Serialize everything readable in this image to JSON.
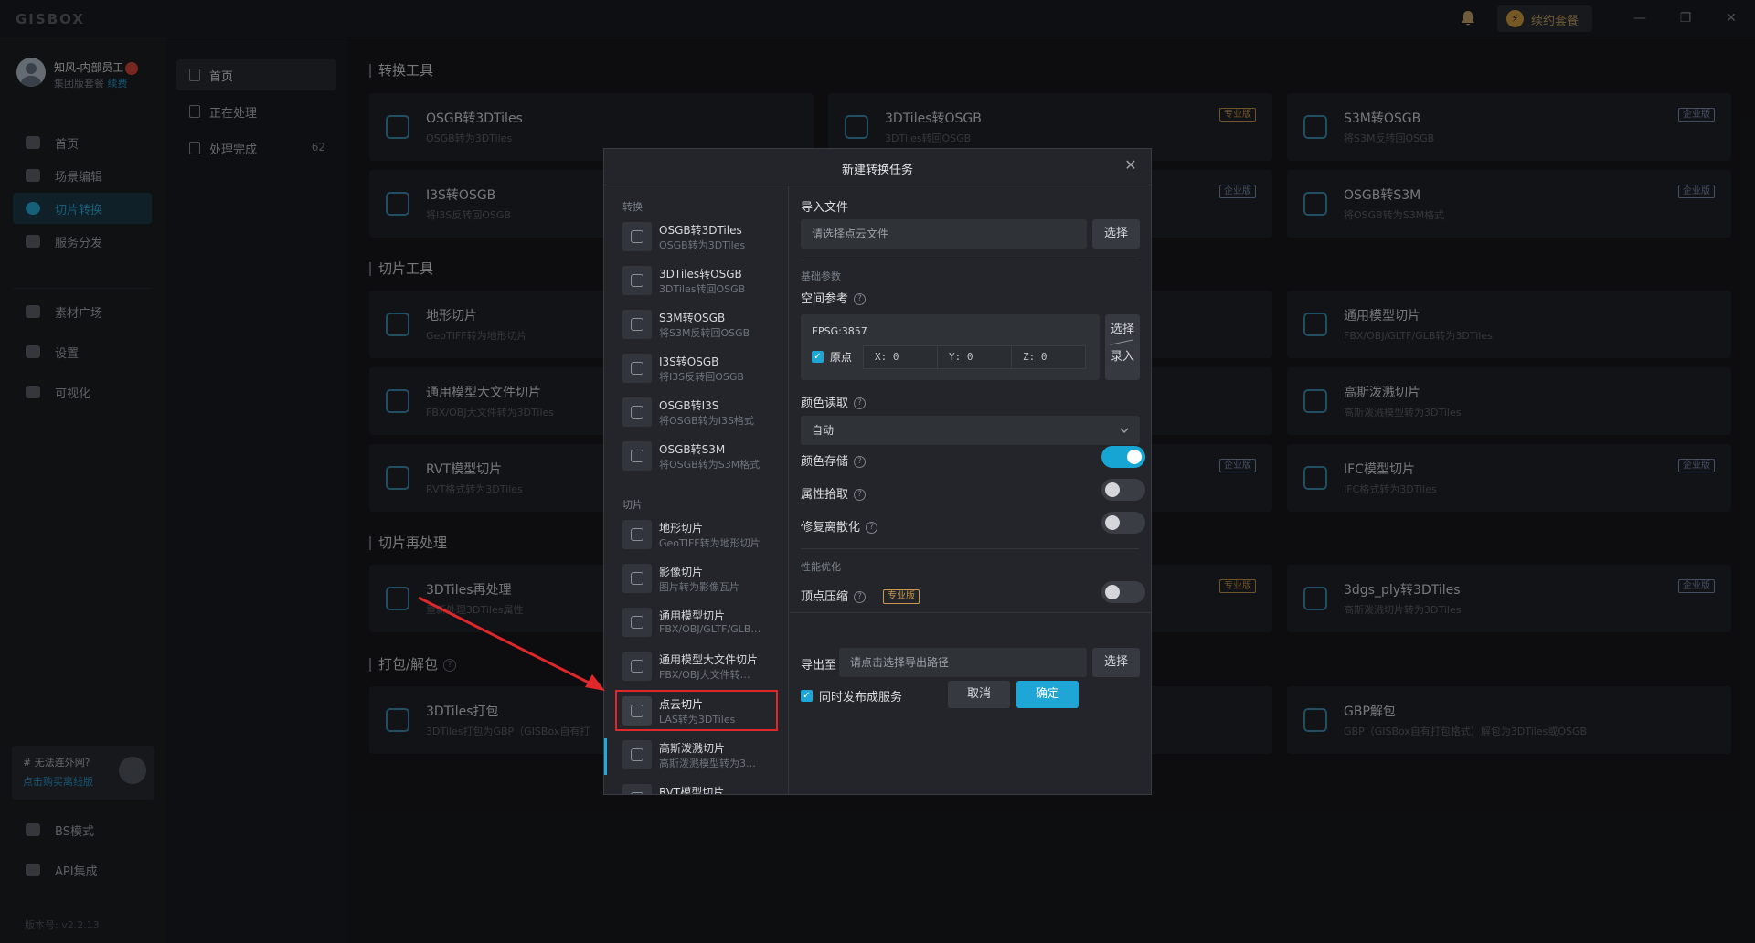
{
  "app": {
    "logo": "GISBOX",
    "renew_label": "续约套餐",
    "win_min": "—",
    "win_restore": "❐",
    "win_close": "✕"
  },
  "user": {
    "name": "知风-内部员工",
    "plan": "集团版套餐",
    "renew": "续费"
  },
  "nav": {
    "items": [
      {
        "label": "首页",
        "icon": "home-icon"
      },
      {
        "label": "场景编辑",
        "icon": "cube-icon"
      },
      {
        "label": "切片转换",
        "icon": "convert-icon"
      },
      {
        "label": "服务分发",
        "icon": "upload-icon"
      },
      {
        "label": "素材广场",
        "icon": "image-icon"
      },
      {
        "label": "设置",
        "icon": "gear-icon"
      },
      {
        "label": "可视化",
        "icon": "chart-icon"
      }
    ],
    "bottom": [
      {
        "label": "BS模式",
        "icon": "code-icon"
      },
      {
        "label": "API集成",
        "icon": "api-icon"
      }
    ],
    "promo_title": "# 无法连外网?",
    "promo_link": "点击购买离线版",
    "version": "版本号: v2.2.13"
  },
  "subnav": {
    "items": [
      {
        "label": "首页",
        "count": ""
      },
      {
        "label": "正在处理",
        "count": ""
      },
      {
        "label": "处理完成",
        "count": "62"
      }
    ]
  },
  "main": {
    "sections": {
      "convert": "转换工具",
      "slice": "切片工具",
      "reprocess": "切片再处理",
      "pack": "打包/解包"
    },
    "cards": {
      "c1": {
        "title": "OSGB转3DTiles",
        "sub": "OSGB转为3DTiles"
      },
      "c2": {
        "title": "3DTiles转OSGB",
        "sub": "3DTiles转回OSGB",
        "badge": "专业版"
      },
      "c3": {
        "title": "S3M转OSGB",
        "sub": "将S3M反转回OSGB",
        "badge": "企业版"
      },
      "c4": {
        "title": "I3S转OSGB",
        "sub": "将I3S反转回OSGB"
      },
      "c5": {
        "badge": "企业版"
      },
      "c6": {
        "title": "OSGB转S3M",
        "sub": "将OSGB转为S3M格式",
        "badge": "企业版"
      },
      "c7": {
        "title": "地形切片",
        "sub": "GeoTIFF转为地形切片"
      },
      "c8": {
        "title": "通用模型切片",
        "sub": "FBX/OBJ/GLTF/GLB转为3DTiles"
      },
      "c9": {
        "title": "通用模型大文件切片",
        "sub": "FBX/OBJ大文件转为3DTiles"
      },
      "c10": {
        "title": "高斯泼溅切片",
        "sub": "高斯泼溅模型转为3DTiles"
      },
      "c11": {
        "title": "RVT模型切片",
        "sub": "RVT格式转为3DTiles"
      },
      "c12": {
        "badge": "企业版"
      },
      "c13": {
        "title": "IFC模型切片",
        "sub": "IFC格式转为3DTiles",
        "badge": "企业版"
      },
      "c14": {
        "title": "3DTiles再处理",
        "sub": "重新处理3DTiles属性"
      },
      "c15": {
        "badge": "专业版"
      },
      "c16": {
        "title": "3dgs_ply转3DTiles",
        "sub": "高斯泼溅切片转为3DTiles",
        "badge": "企业版"
      },
      "c17": {
        "title": "3DTiles打包",
        "sub": "3DTiles打包为GBP（GISBox自有打"
      },
      "c18": {
        "title": "GBP解包",
        "sub": "GBP（GISBox自有打包格式）解包为3DTiles或OSGB"
      }
    }
  },
  "dialog": {
    "title": "新建转换任务",
    "close": "✕",
    "groups": {
      "convert": "转换",
      "slice": "切片"
    },
    "list": [
      {
        "title": "OSGB转3DTiles",
        "sub": "OSGB转为3DTiles"
      },
      {
        "title": "3DTiles转OSGB",
        "sub": "3DTiles转回OSGB"
      },
      {
        "title": "S3M转OSGB",
        "sub": "将S3M反转回OSGB"
      },
      {
        "title": "I3S转OSGB",
        "sub": "将I3S反转回OSGB"
      },
      {
        "title": "OSGB转I3S",
        "sub": "将OSGB转为I3S格式"
      },
      {
        "title": "OSGB转S3M",
        "sub": "将OSGB转为S3M格式"
      },
      {
        "title": "地形切片",
        "sub": "GeoTIFF转为地形切片"
      },
      {
        "title": "影像切片",
        "sub": "图片转为影像瓦片"
      },
      {
        "title": "通用模型切片",
        "sub": "FBX/OBJ/GLTF/GLB…"
      },
      {
        "title": "通用模型大文件切片",
        "sub": "FBX/OBJ大文件转…"
      },
      {
        "title": "点云切片",
        "sub": "LAS转为3DTiles"
      },
      {
        "title": "高斯泼溅切片",
        "sub": "高斯泼溅模型转为3…"
      },
      {
        "title": "RVT模型切片",
        "sub": ""
      }
    ],
    "form": {
      "import_label": "导入文件",
      "import_placeholder": "请选择点云文件",
      "select": "选择",
      "basic_params": "基础参数",
      "spatial_ref": "空间参考",
      "epsg": "EPSG:3857",
      "origin_label": "原点",
      "x": "X: 0",
      "y": "Y: 0",
      "z": "Z: 0",
      "select_entry_1": "选择",
      "select_entry_2": "录入",
      "color_read": "颜色读取",
      "color_read_value": "自动",
      "color_store": "颜色存储",
      "attr_pick": "属性拾取",
      "fix_discrete": "修复离散化",
      "perf": "性能优化",
      "vertex_compress": "顶点压缩",
      "pro_badge": "专业版",
      "export_label": "导出至",
      "export_placeholder": "请点击选择导出路径",
      "publish": "同时发布成服务",
      "cancel": "取消",
      "confirm": "确定",
      "q": "?"
    }
  },
  "colors": {
    "accent": "#1ea6d6",
    "highlight": "#e0282a"
  }
}
